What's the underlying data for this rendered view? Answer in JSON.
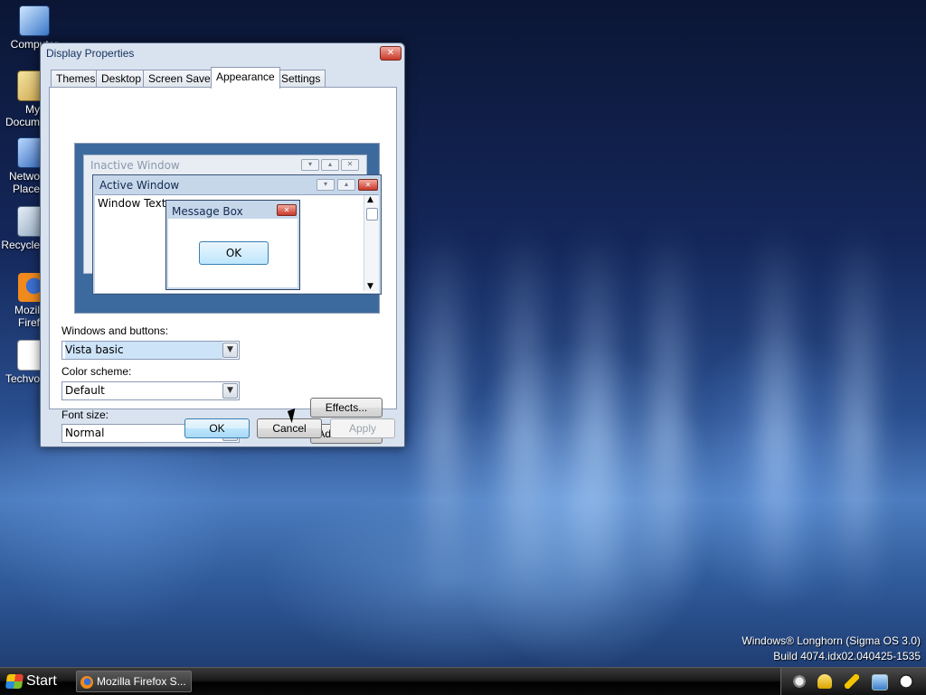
{
  "desktop": {
    "icons": [
      {
        "label": "Computer",
        "icon": "computer-icon"
      },
      {
        "label": "My Documents",
        "icon": "documents-folder-icon"
      },
      {
        "label": "Network Places",
        "icon": "network-icon"
      },
      {
        "label": "Recycle Bin",
        "icon": "recycle-bin-icon"
      },
      {
        "label": "Mozilla Firefox",
        "icon": "firefox-icon"
      },
      {
        "label": "Techvo",
        "icon": "file-shortcut-icon"
      }
    ],
    "icon_labels_visible": [
      "Computer",
      "My\nDocum",
      "Netwo\nPlace",
      "Recycle",
      "Mozil\nFiref",
      "Techvo"
    ],
    "watermark": {
      "line1": "Windows® Longhorn (Sigma OS 3.0)",
      "line2": "Build 4074.idx02.040425-1535"
    }
  },
  "dialog": {
    "title": "Display Properties",
    "close_icon": "close-icon",
    "tabs": [
      {
        "label": "Themes",
        "active": false
      },
      {
        "label": "Desktop",
        "active": false
      },
      {
        "label": "Screen Saver",
        "active": false
      },
      {
        "label": "Appearance",
        "active": true
      },
      {
        "label": "Settings",
        "active": false
      }
    ],
    "preview": {
      "inactive_window_title": "Inactive Window",
      "active_window_title": "Active Window",
      "window_text": "Window Text",
      "message_box_title": "Message Box",
      "message_box_ok": "OK"
    },
    "windows_and_buttons": {
      "label": "Windows and buttons:",
      "value": "Vista basic"
    },
    "color_scheme": {
      "label": "Color scheme:",
      "value": "Default"
    },
    "font_size": {
      "label": "Font size:",
      "value": "Normal"
    },
    "effects_button": "Effects...",
    "advanced_button": "Advanced...",
    "ok_button": "OK",
    "cancel_button": "Cancel",
    "apply_button": "Apply"
  },
  "taskbar": {
    "start_label": "Start",
    "tasks": [
      {
        "label": "Mozilla Firefox S...",
        "icon": "firefox-icon"
      }
    ],
    "tray_icons": [
      "circle-icon",
      "bell-icon",
      "lightning-icon",
      "network-monitor-icon",
      "clock-icon"
    ]
  },
  "colors": {
    "desktop_top": "#0b1635",
    "desktop_glow": "#4c7cbf",
    "dialog_frame": "#d9e2ef",
    "preview_bg": "#3d6a9e",
    "close_red": "#c8392a",
    "taskbar": "#000000"
  }
}
